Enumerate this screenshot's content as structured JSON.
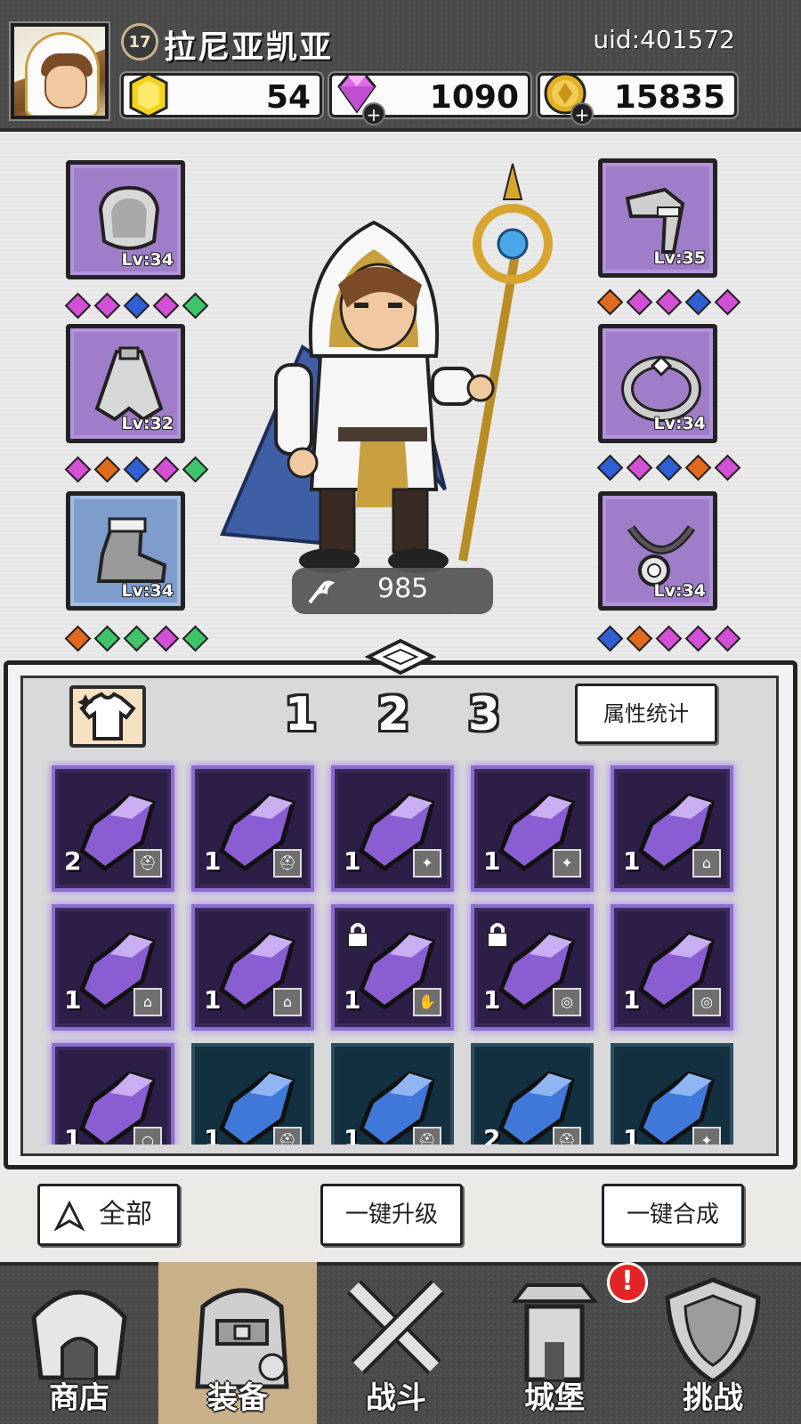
{
  "header": {
    "player_level": "17",
    "player_name": "拉尼亚凯亚",
    "uid": "uid:401572",
    "gold_ingot": "54",
    "diamonds": "1090",
    "coins": "15835"
  },
  "equipment": {
    "left_slots": [
      {
        "item": "helmet",
        "level": "Lv:34",
        "rarity": "purple",
        "gems": [
          "pink",
          "pink",
          "blue",
          "pink",
          "green"
        ]
      },
      {
        "item": "cloak",
        "level": "Lv:32",
        "rarity": "purple",
        "gems": [
          "pink",
          "orange",
          "blue",
          "pink",
          "green"
        ]
      },
      {
        "item": "boots",
        "level": "Lv:34",
        "rarity": "blue",
        "gems": [
          "orange",
          "green",
          "green",
          "pink",
          "green"
        ]
      }
    ],
    "right_slots": [
      {
        "item": "gauntlet",
        "level": "Lv:35",
        "rarity": "purple",
        "gems": [
          "orange",
          "pink",
          "pink",
          "blue",
          "pink"
        ]
      },
      {
        "item": "ring",
        "level": "Lv:34",
        "rarity": "purple",
        "gems": [
          "blue",
          "pink",
          "blue",
          "orange",
          "pink"
        ]
      },
      {
        "item": "necklace",
        "level": "Lv:34",
        "rarity": "purple",
        "gems": [
          "blue",
          "orange",
          "pink",
          "pink",
          "pink"
        ]
      }
    ],
    "power": "985"
  },
  "inventory": {
    "tabs": [
      "1",
      "2",
      "3"
    ],
    "active_tab": "1",
    "attr_button": "属性统计",
    "items": [
      {
        "count": "2",
        "type": "helmet",
        "color": "purple",
        "locked": false
      },
      {
        "count": "1",
        "type": "helmet",
        "color": "purple",
        "locked": false
      },
      {
        "count": "1",
        "type": "cloak",
        "color": "purple",
        "locked": false
      },
      {
        "count": "1",
        "type": "cloak",
        "color": "purple",
        "locked": false
      },
      {
        "count": "1",
        "type": "boots",
        "color": "purple",
        "locked": false
      },
      {
        "count": "1",
        "type": "boots",
        "color": "purple",
        "locked": false
      },
      {
        "count": "1",
        "type": "boots",
        "color": "purple",
        "locked": false
      },
      {
        "count": "1",
        "type": "gauntlet",
        "color": "purple",
        "locked": true
      },
      {
        "count": "1",
        "type": "ring",
        "color": "purple",
        "locked": true
      },
      {
        "count": "1",
        "type": "ring",
        "color": "purple",
        "locked": false
      },
      {
        "count": "1",
        "type": "necklace",
        "color": "purple",
        "locked": false
      },
      {
        "count": "1",
        "type": "helmet",
        "color": "blue",
        "locked": false
      },
      {
        "count": "1",
        "type": "helmet",
        "color": "blue",
        "locked": false
      },
      {
        "count": "2",
        "type": "helmet",
        "color": "blue",
        "locked": false
      },
      {
        "count": "1",
        "type": "cloak",
        "color": "blue",
        "locked": false
      }
    ]
  },
  "actions": {
    "filter_all": "全部",
    "upgrade_all": "一键升级",
    "merge_all": "一键合成"
  },
  "nav": [
    {
      "label": "商店",
      "icon": "shop-icon"
    },
    {
      "label": "装备",
      "icon": "backpack-icon"
    },
    {
      "label": "战斗",
      "icon": "crossed-swords-icon"
    },
    {
      "label": "城堡",
      "icon": "castle-icon"
    },
    {
      "label": "挑战",
      "icon": "shield-icon"
    }
  ],
  "nav_alert": "!",
  "colors": {
    "purple": "#9f7dc8",
    "blue": "#7e9ccc",
    "active_nav": "#c8b089"
  }
}
